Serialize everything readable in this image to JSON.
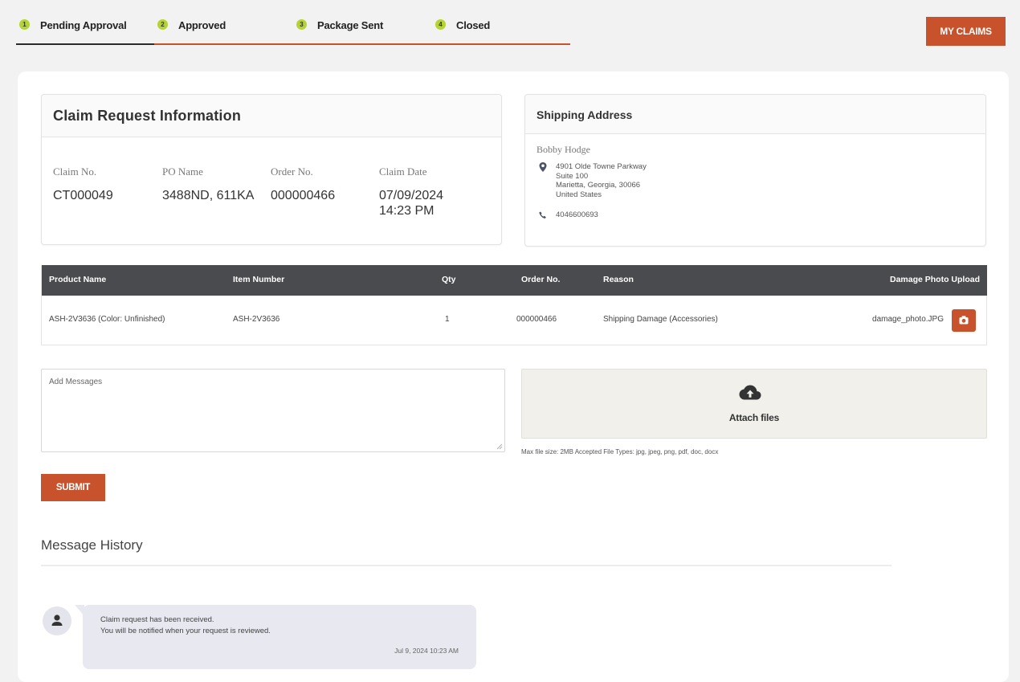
{
  "steps": [
    {
      "num": "1",
      "label": "Pending Approval",
      "active": true
    },
    {
      "num": "2",
      "label": "Approved",
      "active": false
    },
    {
      "num": "3",
      "label": "Package Sent",
      "active": false
    },
    {
      "num": "4",
      "label": "Closed",
      "active": false
    }
  ],
  "header": {
    "my_claims_label": "MY CLAIMS"
  },
  "claim_info": {
    "title": "Claim Request Information",
    "fields": [
      {
        "label": "Claim No.",
        "value": "CT000049"
      },
      {
        "label": "PO Name",
        "value": "3488ND, 611KA"
      },
      {
        "label": "Order No.",
        "value": "000000466"
      },
      {
        "label": "Claim Date",
        "value": "07/09/2024",
        "value2": "14:23 PM"
      }
    ]
  },
  "shipping": {
    "title": "Shipping Address",
    "name": "Bobby Hodge",
    "address_lines": [
      "4901 Olde Towne Parkway",
      "Suite 100",
      "Marietta, Georgia, 30066",
      "United States"
    ],
    "phone": "4046600693",
    "icons": {
      "address": "map-marker-icon",
      "phone": "phone-icon"
    }
  },
  "table": {
    "headers": [
      "Product Name",
      "Item Number",
      "Qty",
      "Order No.",
      "Reason",
      "Damage Photo Upload"
    ],
    "rows": [
      [
        "ASH-2V3636 (Color: Unfinished)",
        "ASH-2V3636",
        "1",
        "000000466",
        "Shipping Damage (Accessories)",
        "damage_photo.JPG"
      ]
    ],
    "upload_icon": "camera-icon"
  },
  "message_form": {
    "placeholder": "Add Messages",
    "attach_label": "Attach files",
    "attach_icon": "cloud-upload-icon",
    "file_info": "Max file size: 2MB Accepted File Types: jpg, jpeg, png, pdf, doc, docx",
    "submit_label": "SUBMIT"
  },
  "history": {
    "title": "Message History",
    "messages": [
      {
        "line1": "Claim request has been received.",
        "line2": "You will be notified when your request is reviewed.",
        "timestamp": "Jul 9, 2024 10:23 AM",
        "avatar_icon": "user-icon"
      }
    ]
  },
  "colors": {
    "accent": "#c8522c",
    "step_badge": "#b5d334",
    "table_header": "#4a4b4f"
  }
}
